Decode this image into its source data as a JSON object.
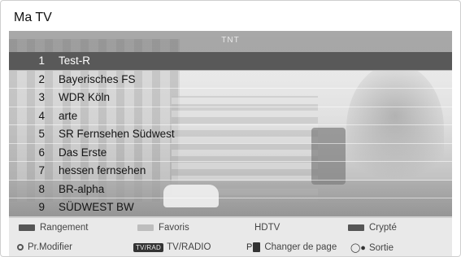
{
  "window": {
    "title": "Ma TV"
  },
  "list": {
    "header": "TNT",
    "selected_index": 0,
    "channels": [
      {
        "number": "1",
        "name": "Test-R"
      },
      {
        "number": "2",
        "name": "Bayerisches FS"
      },
      {
        "number": "3",
        "name": "WDR Köln"
      },
      {
        "number": "4",
        "name": "arte"
      },
      {
        "number": "5",
        "name": "SR Fernsehen Südwest"
      },
      {
        "number": "6",
        "name": "Das Erste"
      },
      {
        "number": "7",
        "name": "hessen fernsehen"
      },
      {
        "number": "8",
        "name": "BR-alpha"
      },
      {
        "number": "9",
        "name": "SÜDWEST BW"
      }
    ]
  },
  "legend": {
    "rangement": "Rangement",
    "favoris": "Favoris",
    "hdtv": "HDTV",
    "crypte": "Crypté",
    "pr_modifier": "Pr.Modifier",
    "tv_radio_key": "TV/RAD",
    "tv_radio": "TV/RADIO",
    "page_key": "P",
    "changer_page": "Changer de page",
    "sortie": "Sortie"
  },
  "icons": {
    "ok": "ok-icon",
    "exit": "exit-icon",
    "page": "page-updown-icon"
  },
  "colors": {
    "selected_row": "#595959",
    "legend_dark": "#555555",
    "legend_light": "#bdbdbd"
  }
}
